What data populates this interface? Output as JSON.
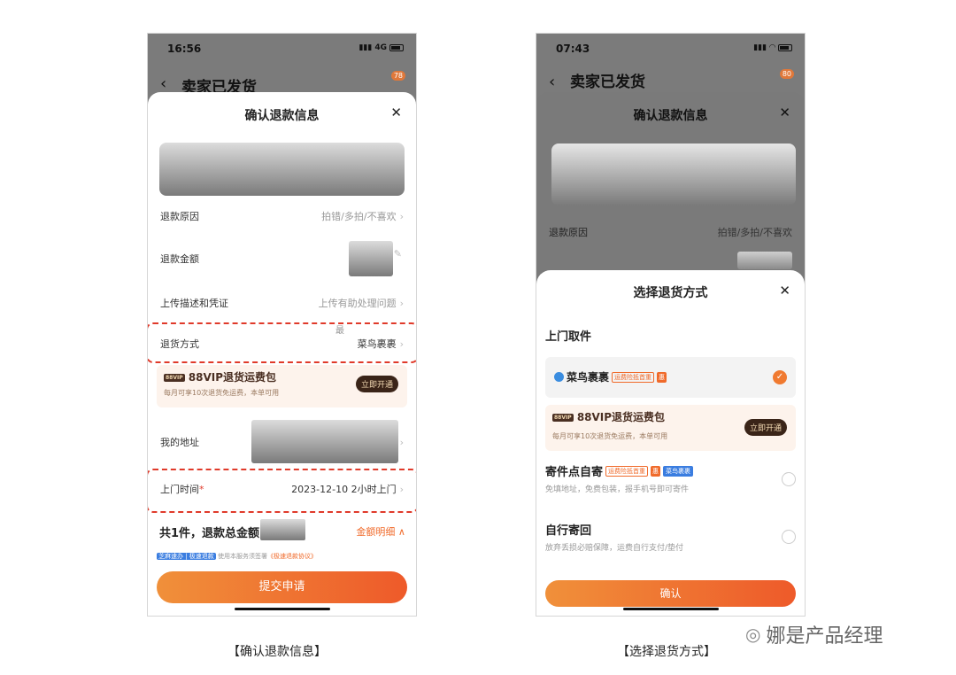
{
  "phone1": {
    "status": {
      "time": "16:56",
      "network": "4G"
    },
    "header": {
      "title": "卖家已发货",
      "badge": "78"
    },
    "sheet": {
      "title": "确认退款信息",
      "rows": [
        {
          "label": "退款原因",
          "value": "拍错/多拍/不喜欢"
        },
        {
          "label": "退款金额",
          "value": "最"
        },
        {
          "label": "上传描述和凭证",
          "value": "上传有助处理问题"
        },
        {
          "label": "退货方式",
          "value": "菜鸟裹裹"
        },
        {
          "label": "我的地址",
          "value": ""
        },
        {
          "label": "上门时间",
          "value": "2023-12-10 2小时上门"
        }
      ],
      "required_mark": "*",
      "vip": {
        "tag": "88VIP",
        "title": "88VIP退货运费包",
        "subtitle": "每月可享10次退货免运费，本单可用",
        "button": "立即开通"
      },
      "total_label": "共1件，退款总金额",
      "detail_label": "金额明细 ∧",
      "agreement": {
        "logo": "芝麻速办 | 极速退款",
        "text": "使用本服务须签署",
        "link": "《极速退款协议》"
      },
      "submit": "提交申请"
    }
  },
  "phone2": {
    "status": {
      "time": "07:43"
    },
    "header": {
      "title": "卖家已发货",
      "badge": "80"
    },
    "bg_sheet": {
      "title": "确认退款信息",
      "row_label": "退款原因",
      "row_value": "拍错/多拍/不喜欢"
    },
    "sheet": {
      "title": "选择退货方式",
      "section": "上门取件",
      "options": [
        {
          "title": "菜鸟裹裹",
          "tag": "运费险抵首重",
          "tag2": "惠"
        },
        {
          "title": "寄件点自寄",
          "tag": "运费险抵首重",
          "tag2": "惠",
          "tag3": "菜鸟裹裹",
          "subtitle": "免填地址，免费包装，报手机号即可寄件"
        },
        {
          "title": "自行寄回",
          "subtitle": "放弃丢损必赔保障，运费自行支付/垫付"
        }
      ],
      "vip": {
        "tag": "88VIP",
        "title": "88VIP退货运费包",
        "subtitle": "每月可享10次退货免运费，本单可用",
        "button": "立即开通"
      },
      "confirm": "确认"
    }
  },
  "captions": {
    "left": "【确认退款信息】",
    "right": "【选择退货方式】"
  },
  "watermark": "娜是产品经理",
  "colors": {
    "accent": "#f06a2a",
    "highlight": "#e03a2a"
  }
}
